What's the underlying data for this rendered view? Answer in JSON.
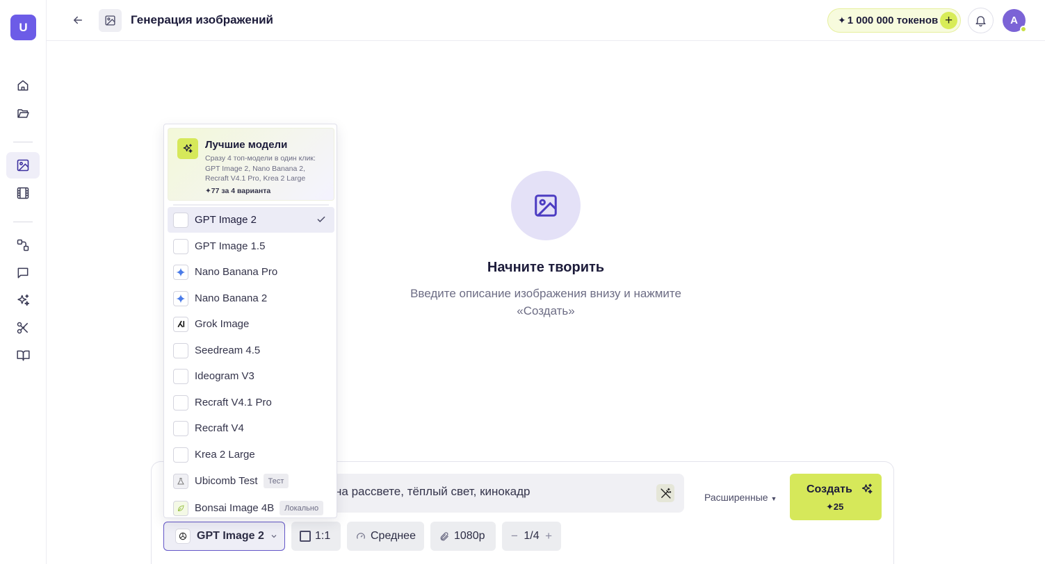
{
  "app": {
    "logo_letter": "U"
  },
  "header": {
    "title": "Генерация изображений",
    "tokens": "1 000 000 токенов",
    "tokens_star": "✦",
    "tokens_plus": "+",
    "avatar_letter": "A"
  },
  "sidebar": {
    "items": [
      {
        "name": "home-icon"
      },
      {
        "name": "folder-icon"
      },
      {
        "name": "image-icon",
        "active": true
      },
      {
        "name": "film-icon"
      },
      {
        "name": "workflow-icon"
      },
      {
        "name": "chat-icon"
      },
      {
        "name": "sparkles-icon"
      },
      {
        "name": "scissors-icon"
      },
      {
        "name": "book-icon"
      }
    ]
  },
  "empty_state": {
    "title": "Начните творить",
    "subtitle": "Введите описание изображения внизу и нажмите «Создать»"
  },
  "prompt": {
    "visible_text": "на рассвете, тёплый свет, кинокадр",
    "advanced_label": "Расширенные",
    "create_label": "Создать",
    "create_cost": "✦25"
  },
  "toolbar": {
    "model": "GPT Image 2",
    "ratio": "1:1",
    "quality": "Среднее",
    "resolution": "1080p",
    "count": "1/4",
    "minus": "−",
    "plus": "+"
  },
  "dropdown": {
    "best": {
      "title": "Лучшие модели",
      "description": "Сразу 4 топ-модели в один клик: GPT Image 2, Nano Banana 2, Recraft V4.1 Pro, Krea 2 Large",
      "cost": "✦77 за 4 варианта"
    },
    "models": [
      {
        "label": "GPT Image 2",
        "selected": true,
        "icon": "openai-icon"
      },
      {
        "label": "GPT Image 1.5",
        "icon": "blank"
      },
      {
        "label": "Nano Banana Pro",
        "icon": "gemini-icon"
      },
      {
        "label": "Nano Banana 2",
        "icon": "gemini-icon"
      },
      {
        "label": "Grok Image",
        "icon": "grok-icon"
      },
      {
        "label": "Seedream 4.5",
        "icon": "blank"
      },
      {
        "label": "Ideogram V3",
        "icon": "blank"
      },
      {
        "label": "Recraft V4.1 Pro",
        "icon": "blank"
      },
      {
        "label": "Recraft V4",
        "icon": "blank"
      },
      {
        "label": "Krea 2 Large",
        "icon": "blank"
      },
      {
        "label": "Ubicomb Test",
        "badge": "Тест",
        "icon": "flask-icon"
      },
      {
        "label": "Bonsai Image 4B",
        "badge": "Локально",
        "icon": "leaf-icon"
      }
    ]
  },
  "colors": {
    "accent": "#6c5ce7",
    "lime": "#d6e85a",
    "text": "#1c1b3a"
  }
}
